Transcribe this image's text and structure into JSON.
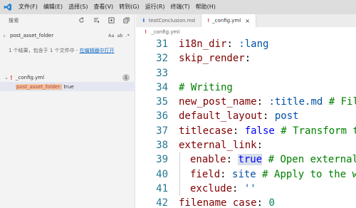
{
  "menubar": {
    "items": [
      "文件(F)",
      "编辑(E)",
      "选择(S)",
      "查看(V)",
      "转到(G)",
      "运行(R)",
      "终端(T)",
      "帮助(H)"
    ]
  },
  "sidebar": {
    "title": "搜索",
    "search_value": "post_asset_folder",
    "opt_case": "Aa",
    "opt_word": "ab",
    "opt_regex": ".*",
    "results_prefix": "1 个结果，包含于 1 个文件中 - ",
    "results_link": "在编辑器中打开",
    "file_name": "_config.yml",
    "file_count": "1",
    "match_highlight": "post_asset_folder:",
    "match_rest": "true"
  },
  "tabs": [
    {
      "label": "testConclusion.md",
      "icon": "markdown-icon",
      "active": false
    },
    {
      "label": "_config.yml",
      "icon": "yaml-icon",
      "active": true
    }
  ],
  "breadcrumb": {
    "file": "_config.yml"
  },
  "code": {
    "lines": [
      {
        "n": "31",
        "parts": [
          [
            "k",
            "i18n_dir"
          ],
          [
            "t",
            ": "
          ],
          [
            "s",
            ":lang"
          ]
        ]
      },
      {
        "n": "32",
        "parts": [
          [
            "k",
            "skip_render"
          ],
          [
            "t",
            ":"
          ]
        ]
      },
      {
        "n": "33",
        "parts": []
      },
      {
        "n": "34",
        "parts": [
          [
            "c",
            "# Writing"
          ]
        ]
      },
      {
        "n": "35",
        "parts": [
          [
            "k",
            "new_post_name"
          ],
          [
            "t",
            ": "
          ],
          [
            "s",
            ":title.md"
          ],
          [
            "c",
            " # File"
          ]
        ]
      },
      {
        "n": "36",
        "parts": [
          [
            "k",
            "default_layout"
          ],
          [
            "t",
            ": "
          ],
          [
            "s",
            "post"
          ]
        ]
      },
      {
        "n": "37",
        "parts": [
          [
            "k",
            "titlecase"
          ],
          [
            "t",
            ": "
          ],
          [
            "b",
            "false"
          ],
          [
            "c",
            " # Transform ti"
          ]
        ]
      },
      {
        "n": "38",
        "parts": [
          [
            "k",
            "external_link"
          ],
          [
            "t",
            ":"
          ]
        ]
      },
      {
        "n": "39",
        "indent": true,
        "parts": [
          [
            "k",
            "enable"
          ],
          [
            "t",
            ": "
          ],
          [
            "bsel",
            "true"
          ],
          [
            "c",
            " # Open external"
          ]
        ]
      },
      {
        "n": "40",
        "indent": true,
        "parts": [
          [
            "k",
            "field"
          ],
          [
            "t",
            ": "
          ],
          [
            "s",
            "site"
          ],
          [
            "c",
            " # Apply to the wh"
          ]
        ]
      },
      {
        "n": "41",
        "indent": true,
        "parts": [
          [
            "k",
            "exclude"
          ],
          [
            "t",
            ": "
          ],
          [
            "s",
            "''"
          ]
        ]
      },
      {
        "n": "42",
        "parts": [
          [
            "k",
            "filename_case"
          ],
          [
            "t",
            ": "
          ],
          [
            "n",
            "0"
          ]
        ]
      }
    ]
  }
}
